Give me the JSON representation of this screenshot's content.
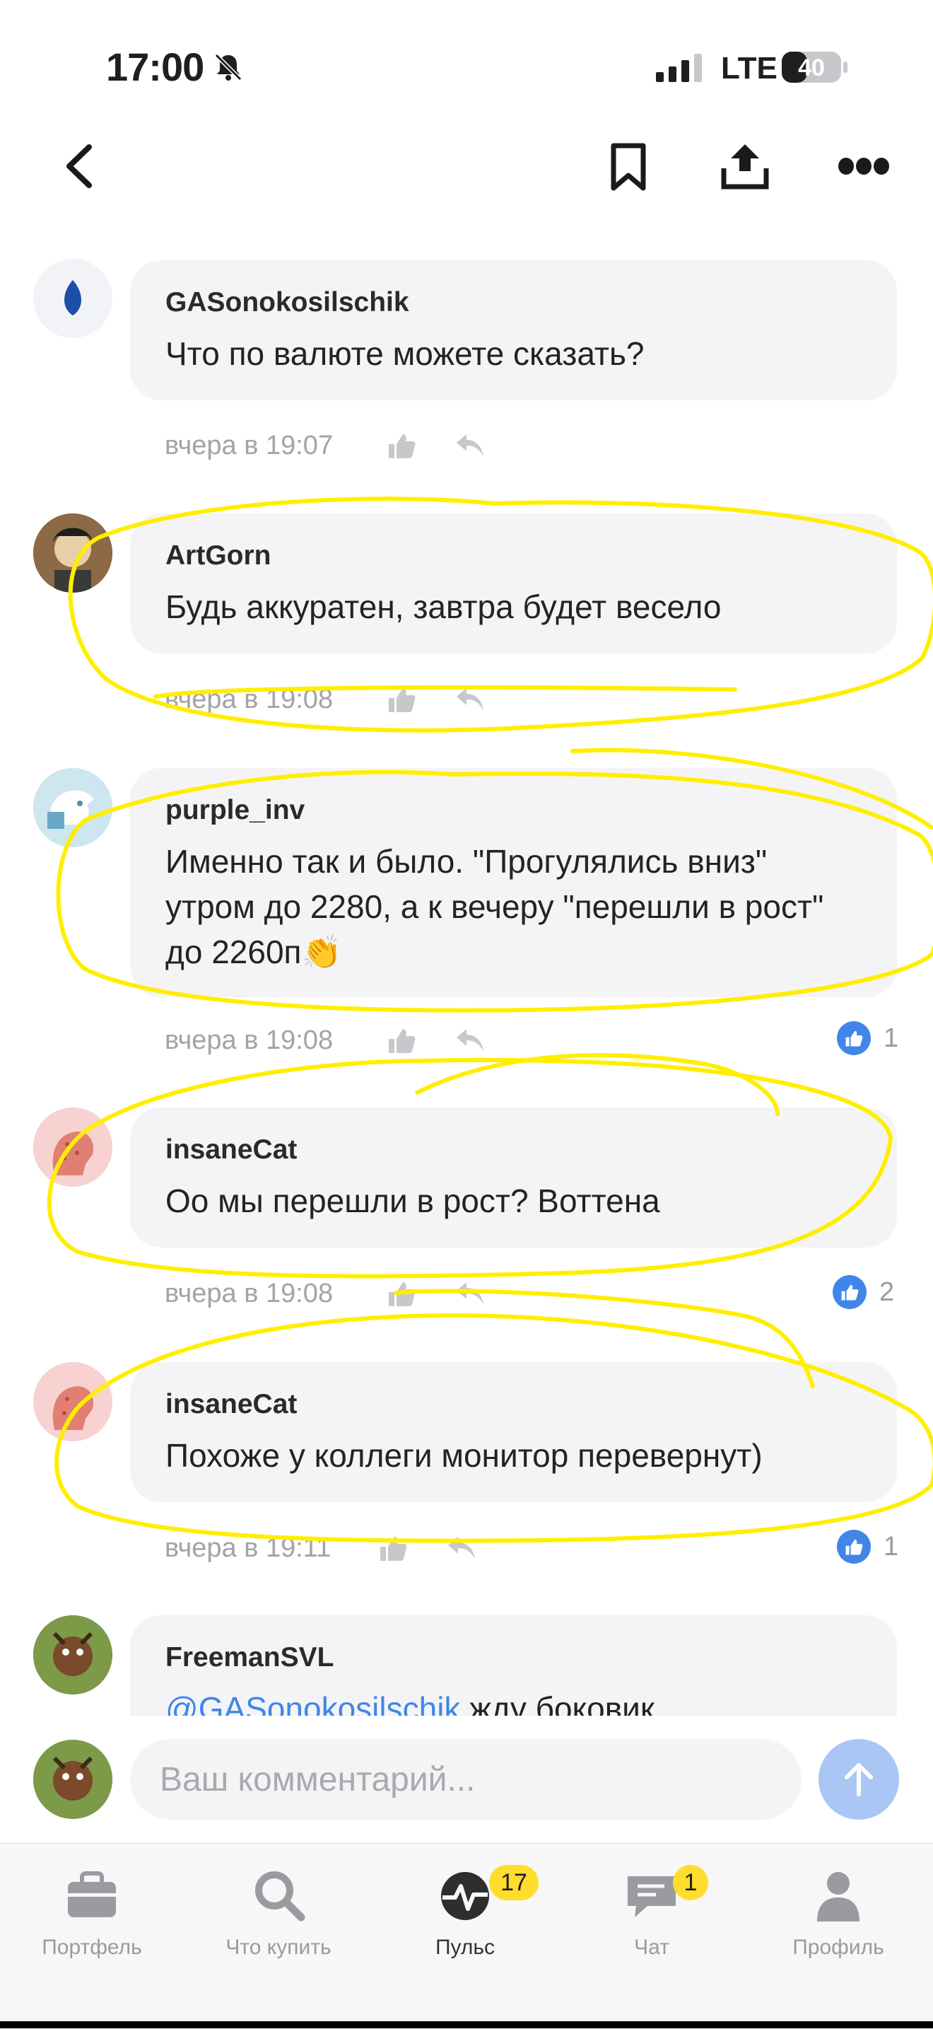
{
  "status_bar": {
    "time": "17:00",
    "network": "LTE",
    "battery": "40"
  },
  "comments": [
    {
      "author": "GASonokosilschik",
      "text": "Что по валюте можете сказать?",
      "time": "вчера в 19:07",
      "likes": ""
    },
    {
      "author": "ArtGorn",
      "text": "Будь аккуратен, завтра будет весело",
      "time": "вчера в 19:08",
      "likes": ""
    },
    {
      "author": "purple_inv",
      "text": "Именно так и было. \"Прогулялись вниз\" утром до 2280, а к вечеру \"перешли в рост\" до 2260п👏",
      "time": "вчера в 19:08",
      "likes": "1"
    },
    {
      "author": "insaneCat",
      "text": "Оо мы перешли в рост? Воттена",
      "time": "вчера в 19:08",
      "likes": "2"
    },
    {
      "author": "insaneCat",
      "text": "Похоже у коллеги монитор перевернут)",
      "time": "вчера в 19:11",
      "likes": "1"
    },
    {
      "author": "FreemanSVL",
      "mention": "@GASonokosilschik",
      "text": " жду боковик",
      "time": "",
      "likes": ""
    }
  ],
  "input": {
    "placeholder": "Ваш комментарий..."
  },
  "tabs": [
    {
      "label": "Портфель",
      "badge": ""
    },
    {
      "label": "Что купить",
      "badge": ""
    },
    {
      "label": "Пульс",
      "badge": "17"
    },
    {
      "label": "Чат",
      "badge": "1"
    },
    {
      "label": "Профиль",
      "badge": ""
    }
  ],
  "colors": {
    "accent": "#3f86e8",
    "highlight": "#ffee00",
    "badge": "#ffdd2d",
    "bubble": "#f4f4f6"
  }
}
